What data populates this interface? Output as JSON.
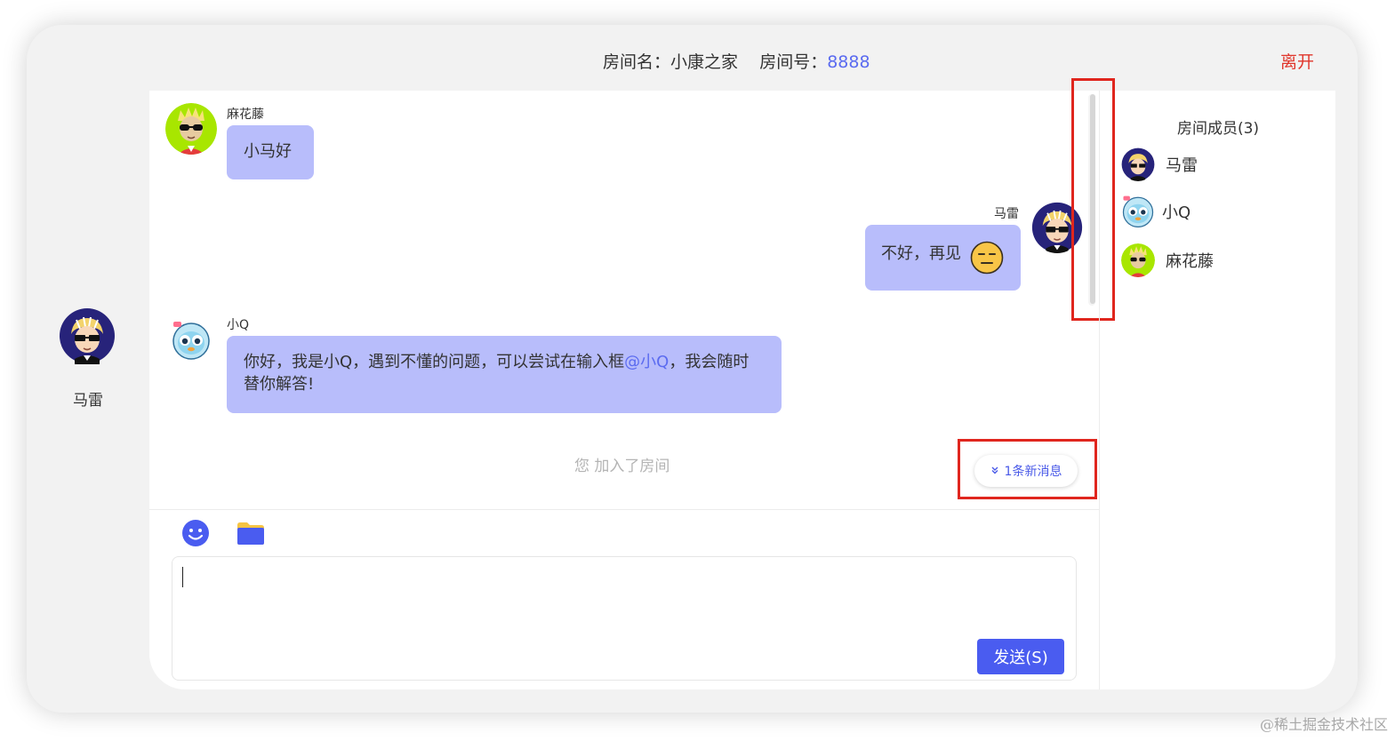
{
  "header": {
    "room_name_label": "房间名：",
    "room_name": "小康之家",
    "room_number_label": "房间号：",
    "room_number": "8888",
    "leave_label": "离开"
  },
  "self_user": {
    "name": "马雷",
    "avatar_icon": "sunglasses-boy-avatar"
  },
  "messages": [
    {
      "sender": "麻花藤",
      "side": "left",
      "text": "小马好",
      "avatar_icon": "lime-sunglasses-avatar"
    },
    {
      "sender": "马雷",
      "side": "right",
      "text": "不好，再见",
      "emoji_icon": "expressionless-face-emoji",
      "avatar_icon": "sunglasses-boy-avatar"
    },
    {
      "sender": "小Q",
      "side": "left",
      "text_before": "你好，我是小Q，遇到不懂的问题，可以尝试在输入框",
      "mention": "@小Q",
      "text_after": "，我会随时替你解答!",
      "avatar_icon": "penguin-bot-avatar"
    }
  ],
  "system_note": "您 加入了房间",
  "new_messages_pill": {
    "label": "1条新消息",
    "icon": "double-chevron-down-icon"
  },
  "toolbar": {
    "emoji_icon": "smiley-face-icon",
    "file_icon": "folder-icon"
  },
  "composer": {
    "value": "",
    "send_label": "发送(S)"
  },
  "members": {
    "title": "房间成员(3)",
    "list": [
      {
        "name": "马雷",
        "avatar_icon": "sunglasses-boy-avatar"
      },
      {
        "name": "小Q",
        "avatar_icon": "penguin-bot-avatar"
      },
      {
        "name": "麻花藤",
        "avatar_icon": "lime-sunglasses-avatar"
      }
    ]
  },
  "watermark": "@稀土掘金技术社区",
  "colors": {
    "accent": "#4a5cf0",
    "bubble": "#b8bdfb",
    "leave": "#e0352b",
    "highlight": "#e0261e",
    "mention": "#5b6bf0"
  }
}
